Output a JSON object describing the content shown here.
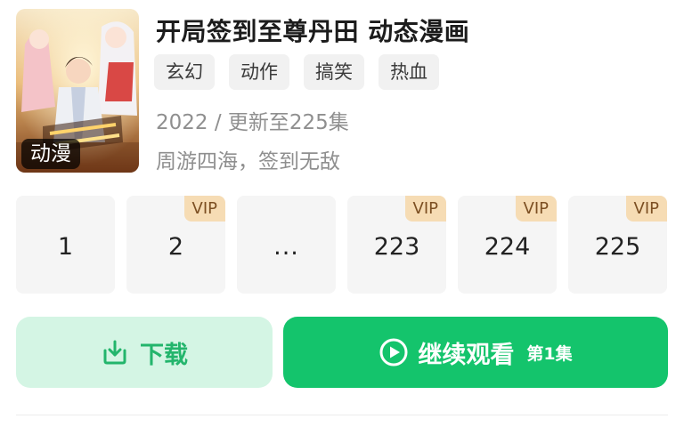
{
  "show": {
    "title": "开局签到至尊丹田 动态漫画",
    "poster_badge": "动漫",
    "tags": [
      "玄幻",
      "动作",
      "搞笑",
      "热血"
    ],
    "meta": "2022 / 更新至225集",
    "description": "周游四海，签到无敌"
  },
  "episodes": [
    {
      "label": "1",
      "vip": false
    },
    {
      "label": "2",
      "vip": true
    },
    {
      "label": "...",
      "vip": false
    },
    {
      "label": "223",
      "vip": true
    },
    {
      "label": "224",
      "vip": true
    },
    {
      "label": "225",
      "vip": true
    }
  ],
  "vip_label": "VIP",
  "actions": {
    "download_label": "下载",
    "continue_label": "继续观看",
    "continue_episode": "第1集"
  },
  "colors": {
    "accent": "#14c46c",
    "download_bg": "#d4f5e4",
    "vip_bg": "#f6dcb4",
    "vip_text": "#7c4f22"
  },
  "icons": {
    "download": "download-icon",
    "play": "play-circle-icon"
  }
}
